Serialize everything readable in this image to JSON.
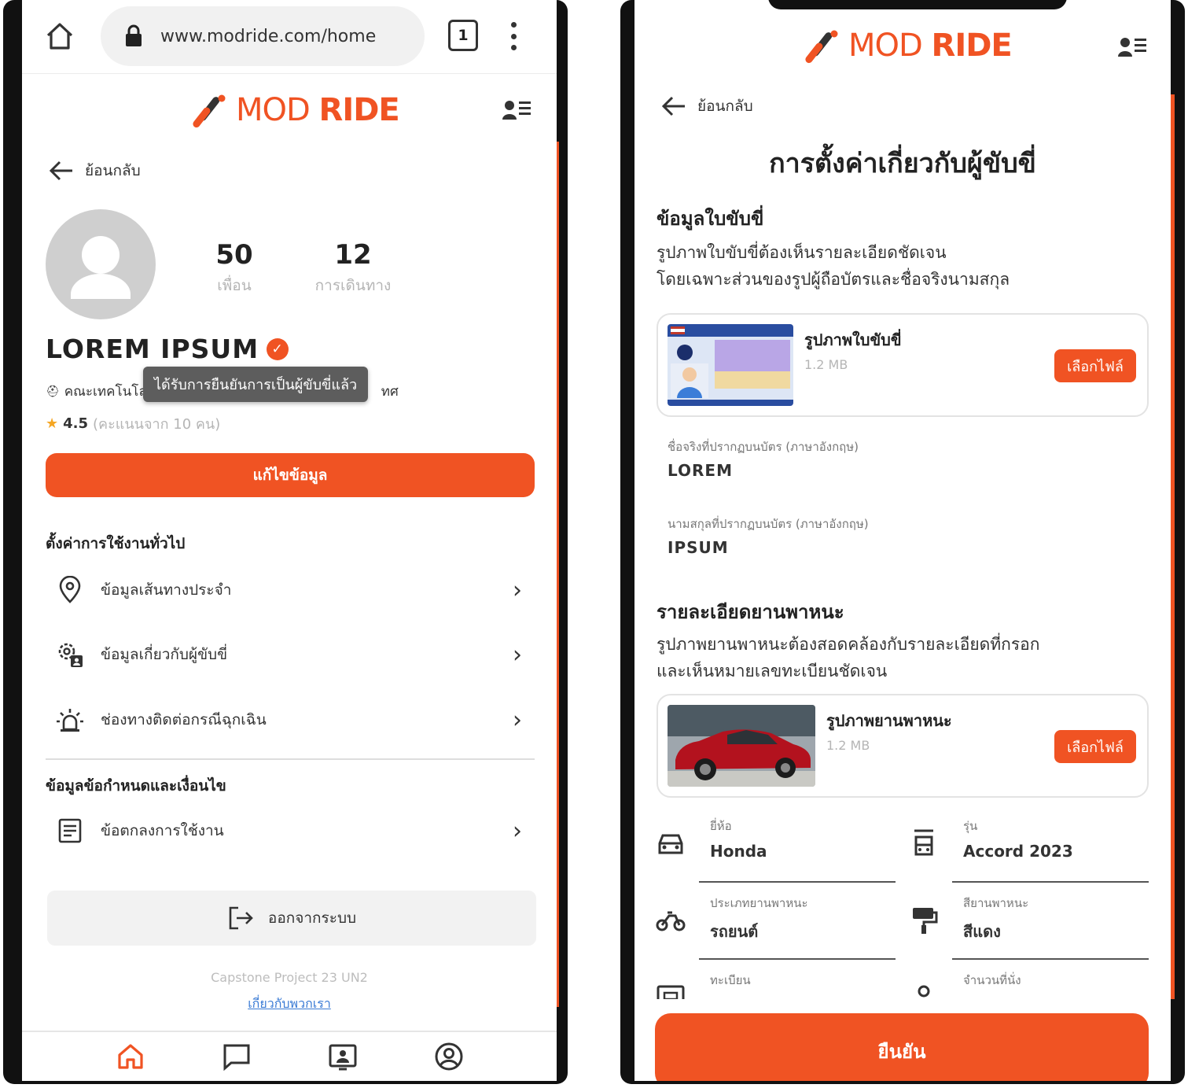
{
  "colors": {
    "accent": "#f05323",
    "text": "#222222",
    "muted": "#b5b5b5"
  },
  "left": {
    "browser": {
      "url": "www.modride.com/home",
      "tab_count": "1"
    },
    "brand": {
      "mod": "MOD",
      "ride": "RIDE"
    },
    "back_label": "ย้อนกลับ",
    "profile": {
      "friends_count": "50",
      "friends_label": "เพื่อน",
      "trips_count": "12",
      "trips_label": "การเดินทาง",
      "name": "LOREM IPSUM",
      "faculty": "คณะเทคโนโลยีสารสนเทศ",
      "faculty_visible_start": "คณะเทคโนโล",
      "faculty_visible_end": "ทศ",
      "verified_tooltip": "ได้รับการยืนยันการเป็นผู้ขับขี่แล้ว",
      "rating": "4.5",
      "rating_count": "(คะแนนจาก 10 คน)"
    },
    "edit_button": "แก้ไขข้อมูล",
    "general_settings_title": "ตั้งค่าการใช้งานทั่วไป",
    "menu": [
      {
        "label": "ข้อมูลเส้นทางประจำ",
        "icon": "location-pin-icon"
      },
      {
        "label": "ข้อมูลเกี่ยวกับผู้ขับขี่",
        "icon": "driver-settings-icon"
      },
      {
        "label": "ช่องทางติดต่อกรณีฉุกเฉิน",
        "icon": "emergency-light-icon"
      }
    ],
    "terms_title": "ข้อมูลข้อกำหนดและเงื่อนไข",
    "terms_item": {
      "label": "ข้อตกลงการใช้งาน",
      "icon": "document-icon"
    },
    "logout_label": "ออกจากระบบ",
    "footer_note": "Capstone Project 23 UN2",
    "footer_link": "เกี่ยวกับพวกเรา",
    "bottom_nav": [
      "home-icon",
      "chat-icon",
      "id-card-icon",
      "profile-icon"
    ]
  },
  "right": {
    "brand": {
      "mod": "MOD",
      "ride": "RIDE"
    },
    "back_label": "ย้อนกลับ",
    "page_title": "การตั้งค่าเกี่ยวกับผู้ขับขี่",
    "license_section": {
      "title": "ข้อมูลใบขับขี่",
      "desc_line1": "รูปภาพใบขับขี่ต้องเห็นรายละเอียดชัดเจน",
      "desc_line2": "โดยเฉพาะส่วนของรูปผู้ถือบัตรและชื่อจริงนามสกุล",
      "card_title": "รูปภาพใบขับขี่",
      "card_size": "1.2 MB",
      "pick_button": "เลือกไฟล์",
      "first_name_label": "ชื่อจริงที่ปรากฏบนบัตร (ภาษาอังกฤษ)",
      "first_name": "LOREM",
      "last_name_label": "นามสกุลที่ปรากฏบนบัตร (ภาษาอังกฤษ)",
      "last_name": "IPSUM"
    },
    "vehicle_section": {
      "title": "รายละเอียดยานพาหนะ",
      "desc_line1": "รูปภาพยานพาหนะต้องสอดคล้องกับรายละเอียดที่กรอก",
      "desc_line2": "และเห็นหมายเลขทะเบียนชัดเจน",
      "card_title": "รูปภาพยานพาหนะ",
      "card_size": "1.2 MB",
      "pick_button": "เลือกไฟล์",
      "fields": {
        "brand_label": "ยี่ห้อ",
        "brand": "Honda",
        "model_label": "รุ่น",
        "model": "Accord 2023",
        "type_label": "ประเภทยานพาหนะ",
        "type": "รถยนต์",
        "color_label": "สียานพาหนะ",
        "color": "สีแดง",
        "plate_label": "ทะเบียน",
        "seats_label": "จำนวนที่นั่ง"
      }
    },
    "confirm_button": "ยืนยัน"
  }
}
